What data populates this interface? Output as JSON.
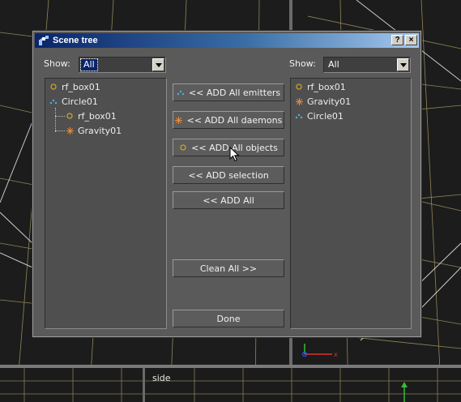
{
  "dialog": {
    "title": "Scene tree",
    "help_label": "?",
    "close_label": "×"
  },
  "left": {
    "show_label": "Show:",
    "show_value": "All",
    "tree": [
      {
        "label": "rf_box01",
        "icon": "object-ring-icon",
        "level": 0
      },
      {
        "label": "Circle01",
        "icon": "emitter-dots-icon",
        "level": 0
      },
      {
        "label": "rf_box01",
        "icon": "object-ring-icon",
        "level": 1
      },
      {
        "label": "Gravity01",
        "icon": "daemon-star-icon",
        "level": 1
      }
    ]
  },
  "right": {
    "show_label": "Show:",
    "show_value": "All",
    "tree": [
      {
        "label": "rf_box01",
        "icon": "object-ring-icon"
      },
      {
        "label": "Gravity01",
        "icon": "daemon-star-icon"
      },
      {
        "label": "Circle01",
        "icon": "emitter-dots-icon"
      }
    ]
  },
  "buttons": {
    "add_emitters": "<< ADD All emitters",
    "add_daemons": "<< ADD All daemons",
    "add_objects": "<< ADD All objects",
    "add_selection": "<< ADD selection",
    "add_all": "<< ADD All",
    "clean_all": "Clean All >>",
    "done": "Done"
  },
  "viewport": {
    "label": "side"
  },
  "colors": {
    "object_icon": "#c8a030",
    "emitter_icon": "#4fb0e0",
    "daemon_icon": "#e88a3a",
    "grid_line": "#b5a56a",
    "axis_x": "#e03030",
    "axis_y": "#30c030",
    "axis_z": "#3050e0"
  }
}
